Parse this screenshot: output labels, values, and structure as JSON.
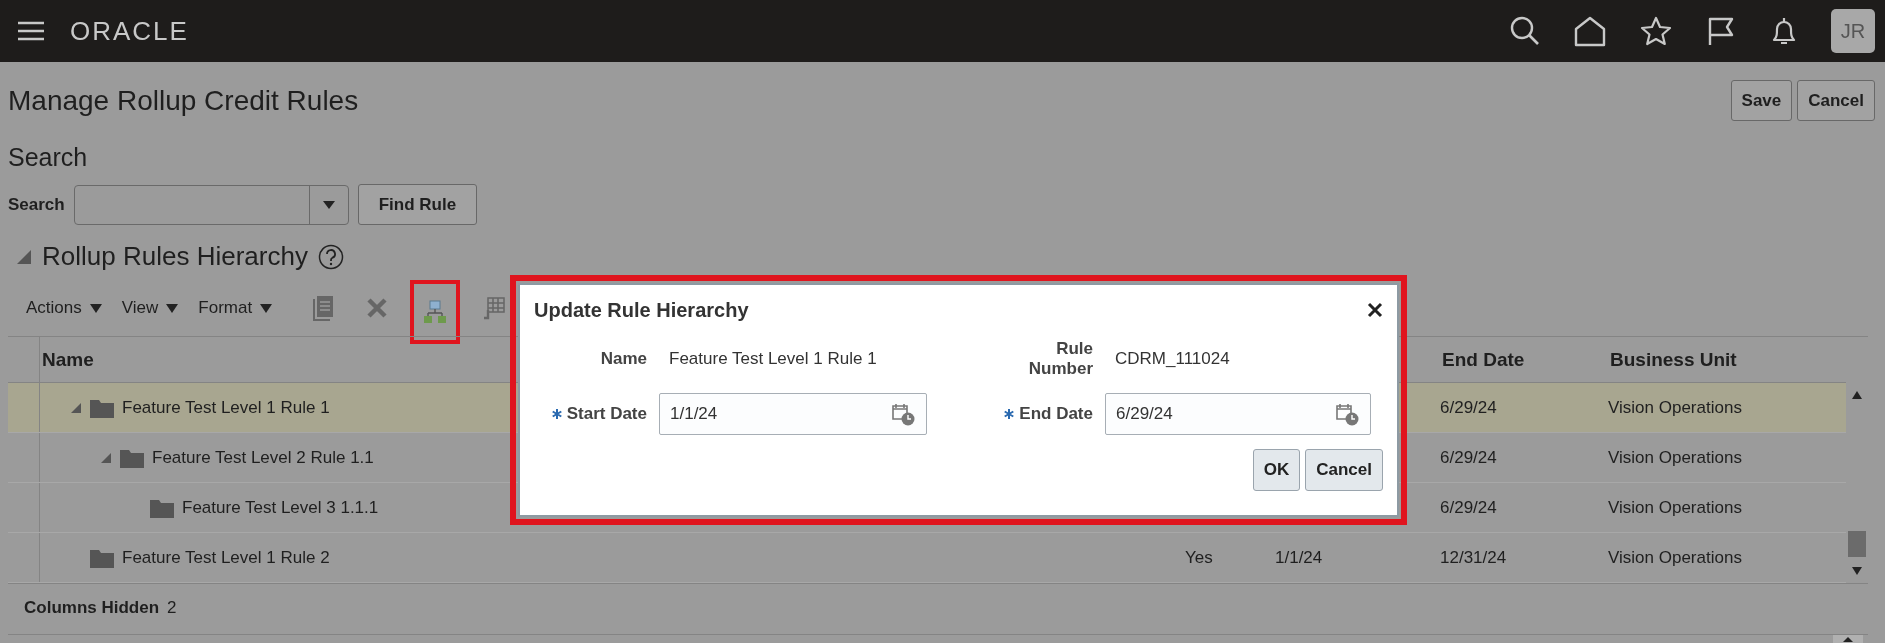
{
  "header": {
    "logo": "ORACLE",
    "avatar": "JR"
  },
  "page": {
    "title": "Manage Rollup Credit Rules",
    "buttons": [
      "Save",
      "Cancel"
    ]
  },
  "search": {
    "heading": "Search",
    "label": "Search",
    "button": "Find Rule"
  },
  "hierarchy": {
    "title": "Rollup Rules Hierarchy",
    "expanded": true,
    "menus": [
      "Actions",
      "View",
      "Format"
    ],
    "table": {
      "columns": [
        {
          "label": "Name"
        },
        {
          "label": "End Date"
        },
        {
          "label": "Business Unit"
        }
      ],
      "rows": [
        {
          "name": "Feature Test Level 1 Rule 1",
          "expanded": true,
          "selected": true,
          "end_date": "6/29/24",
          "business_unit": "Vision Operations",
          "children": [
            {
              "name": "Feature Test Level 2 Rule 1.1",
              "expanded": true,
              "selected": false,
              "end_date": "6/29/24",
              "business_unit": "Vision Operations",
              "children": [
                {
                  "name": "Feature Test Level 3 1.1.1",
                  "selected": false,
                  "end_date": "6/29/24",
                  "business_unit": "Vision Operations"
                }
              ]
            }
          ]
        },
        {
          "name": "Feature Test Level 1 Rule 2",
          "selected": false,
          "column_2": "Yes",
          "column_3": "1/1/24",
          "end_date": "12/31/24",
          "business_unit": "Vision Operations"
        }
      ]
    },
    "footer": {
      "label": "Columns Hidden",
      "count": "2"
    }
  },
  "dialog": {
    "title": "Update Rule Hierarchy",
    "fields": [
      {
        "kind": "text",
        "label": "Name",
        "value": "Feature Test Level 1 Rule 1",
        "required": false
      },
      {
        "kind": "text",
        "label": "Rule Number",
        "value": "CDRM_111024",
        "required": false
      },
      {
        "kind": "date",
        "label": "Start Date",
        "value": "1/1/24",
        "required": true
      },
      {
        "kind": "date",
        "label": "End Date",
        "value": "6/29/24",
        "required": true
      }
    ],
    "buttons": [
      "OK",
      "Cancel"
    ]
  }
}
